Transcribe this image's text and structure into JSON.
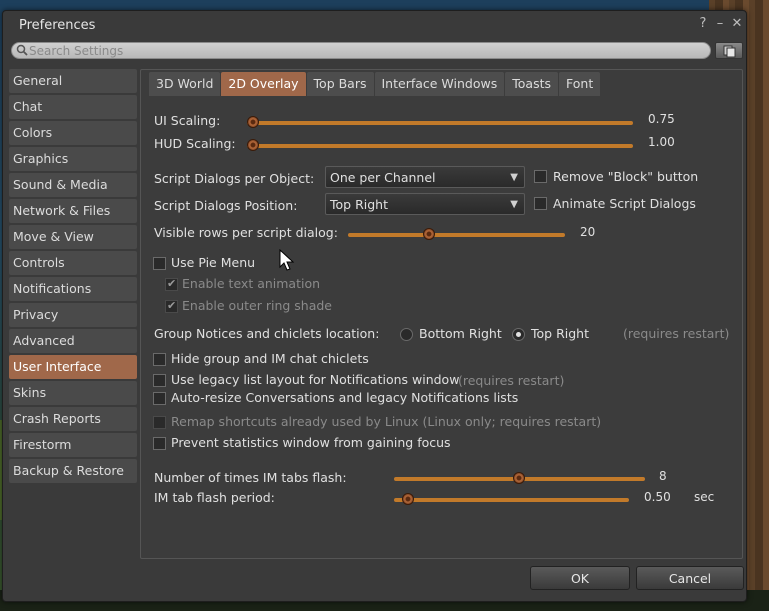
{
  "window": {
    "title": "Preferences",
    "help": "?",
    "minimize": "–",
    "close": "✕"
  },
  "search": {
    "placeholder": "Search Settings"
  },
  "sidebar": {
    "items": [
      {
        "label": "General"
      },
      {
        "label": "Chat"
      },
      {
        "label": "Colors"
      },
      {
        "label": "Graphics"
      },
      {
        "label": "Sound & Media"
      },
      {
        "label": "Network & Files"
      },
      {
        "label": "Move & View"
      },
      {
        "label": "Controls"
      },
      {
        "label": "Notifications"
      },
      {
        "label": "Privacy"
      },
      {
        "label": "Advanced"
      },
      {
        "label": "User Interface"
      },
      {
        "label": "Skins"
      },
      {
        "label": "Crash Reports"
      },
      {
        "label": "Firestorm"
      },
      {
        "label": "Backup & Restore"
      }
    ],
    "active": "User Interface"
  },
  "tabs": [
    "3D World",
    "2D Overlay",
    "Top Bars",
    "Interface Windows",
    "Toasts",
    "Font"
  ],
  "active_tab": "2D Overlay",
  "ui_scaling": {
    "label": "UI Scaling:",
    "value": "0.75",
    "level": 0.0
  },
  "hud_scaling": {
    "label": "HUD Scaling:",
    "value": "1.00",
    "level": 0.0
  },
  "script_dialogs_per_object": {
    "label": "Script Dialogs per Object:",
    "selected": "One per Channel"
  },
  "remove_block": {
    "label": "Remove \"Block\" button",
    "checked": false
  },
  "script_dialogs_position": {
    "label": "Script Dialogs Position:",
    "selected": "Top Right"
  },
  "animate_dialogs": {
    "label": "Animate Script Dialogs",
    "checked": false
  },
  "visible_rows": {
    "label": "Visible rows per script dialog:",
    "value": "20",
    "level": 0.37
  },
  "pie_menu": {
    "label": "Use Pie Menu",
    "checked": false
  },
  "text_animation": {
    "label": "Enable text animation",
    "checked": true,
    "disabled": true
  },
  "outer_ring": {
    "label": "Enable outer ring shade",
    "checked": true,
    "disabled": true
  },
  "group_notices": {
    "label": "Group Notices and chiclets location:",
    "options": [
      "Bottom Right",
      "Top Right"
    ],
    "selected": "Top Right",
    "note": "(requires restart)"
  },
  "hide_chiclets": {
    "label": "Hide group and IM chat chiclets",
    "checked": false
  },
  "legacy_list": {
    "label": "Use legacy list layout for Notifications window",
    "note": "(requires restart)",
    "checked": false
  },
  "auto_resize": {
    "label": "Auto-resize Conversations and legacy Notifications lists",
    "checked": false
  },
  "remap_shortcuts": {
    "label": "Remap shortcuts already used by Linux (Linux only; requires restart)",
    "checked": false,
    "disabled": true
  },
  "prevent_focus": {
    "label": "Prevent statistics window from gaining focus",
    "checked": false
  },
  "im_flash_times": {
    "label": "Number of times IM tabs flash:",
    "value": "8",
    "level": 0.5
  },
  "im_flash_period": {
    "label": "IM tab flash period:",
    "value": "0.50",
    "unit": "sec",
    "level": 0.06
  },
  "buttons": {
    "ok": "OK",
    "cancel": "Cancel"
  }
}
